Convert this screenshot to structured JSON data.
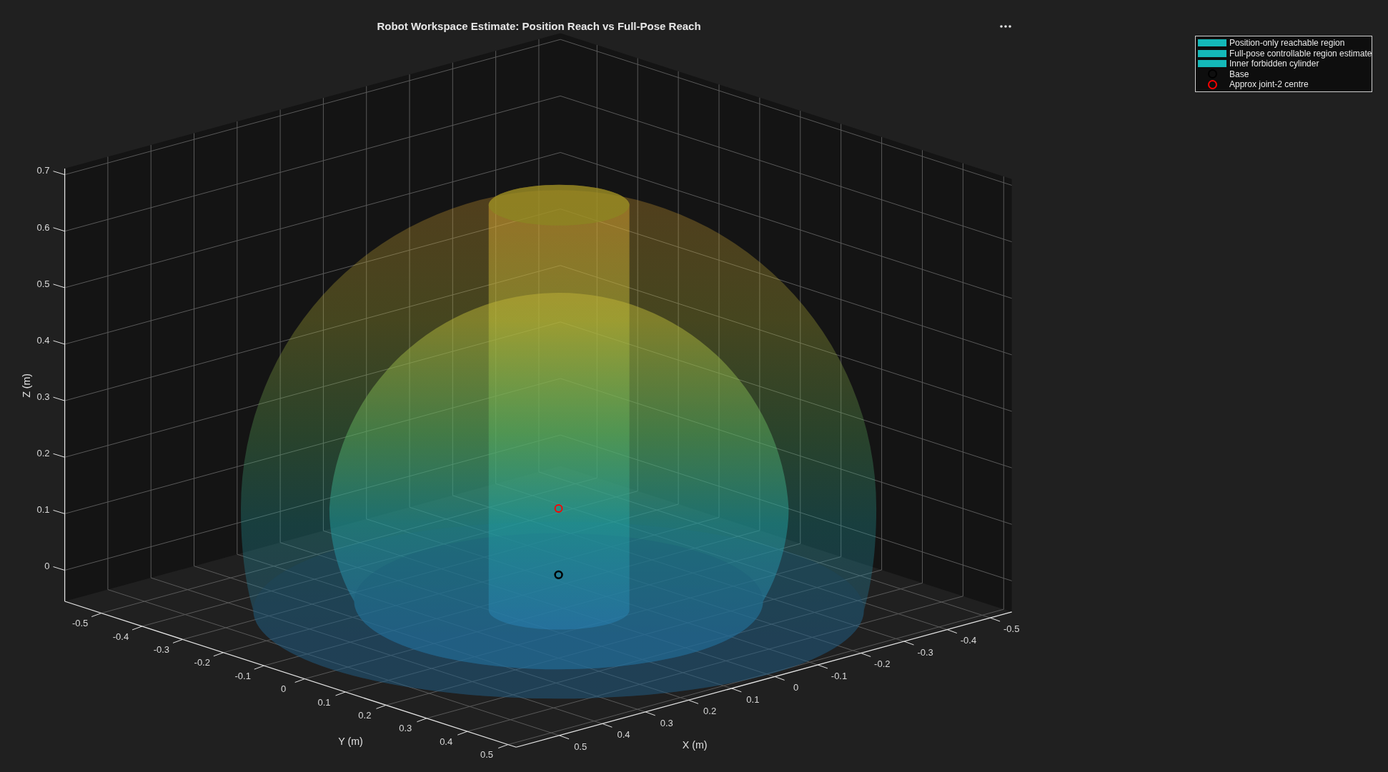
{
  "title": "Robot Workspace Estimate: Position Reach vs Full-Pose Reach",
  "axes": {
    "xlabel": "X (m)",
    "ylabel": "Y (m)",
    "zlabel": "Z (m)",
    "xticks": [
      "-0.5",
      "-0.4",
      "-0.3",
      "-0.2",
      "-0.1",
      "0",
      "0.1",
      "0.2",
      "0.3",
      "0.4",
      "0.5"
    ],
    "yticks": [
      "-0.5",
      "-0.4",
      "-0.3",
      "-0.2",
      "-0.1",
      "0",
      "0.1",
      "0.2",
      "0.3",
      "0.4",
      "0.5"
    ],
    "zticks": [
      "0.7",
      "0.6",
      "0.5",
      "0.4",
      "0.3",
      "0.2",
      "0.1",
      "0"
    ]
  },
  "legend": [
    {
      "label": "Position-only reachable region",
      "kind": "patch",
      "color": "#14b8b8"
    },
    {
      "label": "Full-pose controllable region estimate",
      "kind": "patch",
      "color": "#14b8b8"
    },
    {
      "label": "Inner forbidden cylinder",
      "kind": "patch",
      "color": "#14b8b8"
    },
    {
      "label": "Base",
      "kind": "marker",
      "color": "#000000"
    },
    {
      "label": "Approx joint-2 centre",
      "kind": "marker",
      "color": "#ff0000"
    }
  ]
}
